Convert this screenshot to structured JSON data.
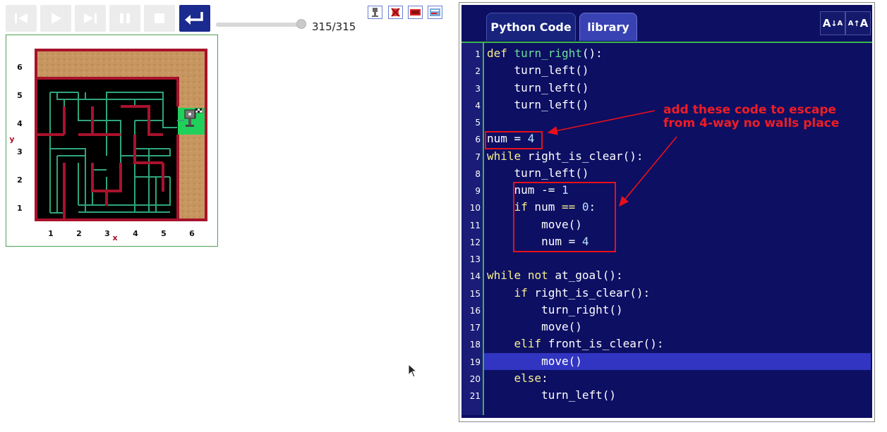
{
  "toolbar": {
    "buttons": [
      {
        "name": "reverse-step",
        "icon": "skip-back-icon"
      },
      {
        "name": "run",
        "icon": "play-icon"
      },
      {
        "name": "step",
        "icon": "skip-forward-icon"
      },
      {
        "name": "pause",
        "icon": "pause-icon"
      },
      {
        "name": "stop",
        "icon": "stop-icon"
      },
      {
        "name": "reload",
        "icon": "return-icon"
      }
    ],
    "slider_value": 315,
    "slider_max": 315,
    "counter": "315/315",
    "world_icons": [
      "robot-icon",
      "remove-robot-icon",
      "edit-world-icon",
      "world-info-icon"
    ]
  },
  "world": {
    "x_axis_label": "x",
    "y_axis_label": "y",
    "x_ticks": [
      "1",
      "2",
      "3",
      "4",
      "5",
      "6"
    ],
    "y_ticks": [
      "1",
      "2",
      "3",
      "4",
      "5",
      "6"
    ],
    "colors": {
      "wall": "#a8122b",
      "path": "#2fa57a",
      "floor": "#000000",
      "sand": "#c79660",
      "goal": "#21d05a"
    }
  },
  "editor": {
    "tabs": [
      "Python Code",
      "library"
    ],
    "font_buttons": [
      {
        "big": "A",
        "small": "A",
        "name": "decrease-font"
      },
      {
        "big": "A",
        "small": "A",
        "name": "increase-font"
      }
    ],
    "highlight_line": 19,
    "lines": [
      [
        [
          "kw",
          "def"
        ],
        [
          "",
          ""
        ],
        [
          "fn",
          " turn_right"
        ],
        [
          "",
          "():"
        ]
      ],
      [
        [
          "",
          "    turn_left()"
        ]
      ],
      [
        [
          "",
          "    turn_left()"
        ]
      ],
      [
        [
          "",
          "    turn_left()"
        ]
      ],
      [],
      [
        [
          "",
          "num = "
        ],
        [
          "num",
          "4"
        ]
      ],
      [
        [
          "kw",
          "while"
        ],
        [
          "",
          " right_is_clear():"
        ]
      ],
      [
        [
          "",
          "    turn_left()"
        ]
      ],
      [
        [
          "",
          "    num -= "
        ],
        [
          "num",
          "1"
        ]
      ],
      [
        [
          "",
          "    "
        ],
        [
          "kw",
          "if"
        ],
        [
          "",
          " num "
        ],
        [
          "kw",
          "=="
        ],
        [
          "",
          " "
        ],
        [
          "num",
          "0"
        ],
        [
          "",
          ":"
        ]
      ],
      [
        [
          "",
          "        move()"
        ]
      ],
      [
        [
          "",
          "        num = "
        ],
        [
          "num",
          "4"
        ]
      ],
      [],
      [
        [
          "kw",
          "while"
        ],
        [
          "",
          " "
        ],
        [
          "kw",
          "not"
        ],
        [
          "",
          " at_goal():"
        ]
      ],
      [
        [
          "",
          "    "
        ],
        [
          "kw",
          "if"
        ],
        [
          "",
          " right_is_clear():"
        ]
      ],
      [
        [
          "",
          "        turn_right()"
        ]
      ],
      [
        [
          "",
          "        move()"
        ]
      ],
      [
        [
          "",
          "    "
        ],
        [
          "kw",
          "elif"
        ],
        [
          "",
          " front_is_clear():"
        ]
      ],
      [
        [
          "",
          "        move()"
        ]
      ],
      [
        [
          "",
          "    "
        ],
        [
          "kw",
          "else"
        ],
        [
          "",
          ":"
        ]
      ],
      [
        [
          "",
          "        turn_left()"
        ]
      ]
    ],
    "annotation": [
      "add these code to escape",
      "from 4-way no walls place"
    ]
  }
}
